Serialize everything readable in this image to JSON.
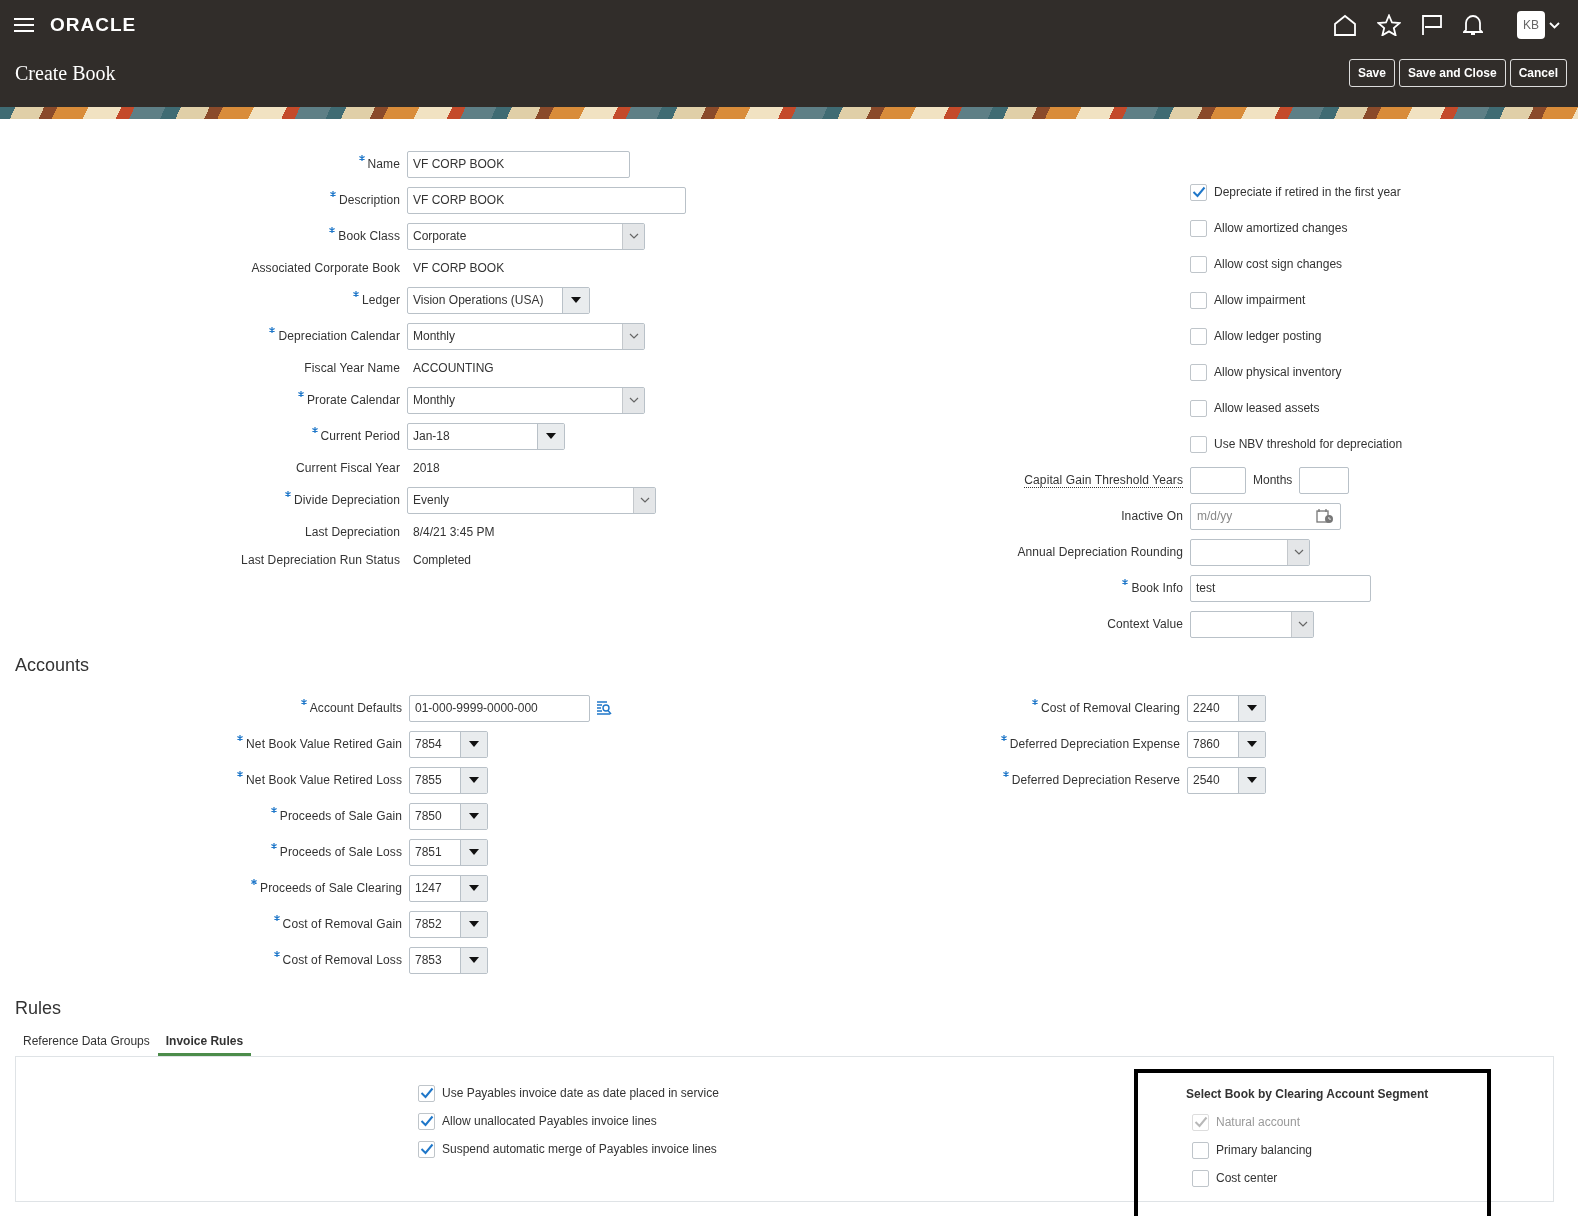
{
  "header": {
    "logo": "ORACLE",
    "avatar": "KB"
  },
  "page_title": "Create Book",
  "buttons": [
    "Save",
    "Save and Close",
    "Cancel"
  ],
  "book_fields": [
    {
      "kind": "text",
      "label": "Name",
      "required": true,
      "value": "VF CORP BOOK"
    },
    {
      "kind": "text",
      "label": "Description",
      "required": true,
      "value": "VF CORP BOOK"
    },
    {
      "kind": "select",
      "label": "Book Class",
      "required": true,
      "value": "Corporate"
    },
    {
      "kind": "display",
      "label": "Associated Corporate Book",
      "required": false,
      "value": "VF CORP BOOK"
    },
    {
      "kind": "combo",
      "label": "Ledger",
      "required": true,
      "value": "Vision Operations (USA)"
    },
    {
      "kind": "select",
      "label": "Depreciation Calendar",
      "required": true,
      "value": "Monthly"
    },
    {
      "kind": "display",
      "label": "Fiscal Year Name",
      "required": false,
      "value": "ACCOUNTING"
    },
    {
      "kind": "select",
      "label": "Prorate Calendar",
      "required": true,
      "value": "Monthly"
    },
    {
      "kind": "combo",
      "label": "Current Period",
      "required": true,
      "value": "Jan-18"
    },
    {
      "kind": "display",
      "label": "Current Fiscal Year",
      "required": false,
      "value": "2018"
    },
    {
      "kind": "select",
      "label": "Divide Depreciation",
      "required": true,
      "value": "Evenly"
    },
    {
      "kind": "display",
      "label": "Last Depreciation",
      "required": false,
      "value": "8/4/21 3:45 PM"
    },
    {
      "kind": "display",
      "label": "Last Depreciation Run Status",
      "required": false,
      "value": "Completed"
    }
  ],
  "book_options": [
    {
      "label": "Depreciate if retired in the first year",
      "checked": true
    },
    {
      "label": "Allow amortized changes",
      "checked": false
    },
    {
      "label": "Allow cost sign changes",
      "checked": false
    },
    {
      "label": "Allow impairment",
      "checked": false
    },
    {
      "label": "Allow ledger posting",
      "checked": false
    },
    {
      "label": "Allow physical inventory",
      "checked": false
    },
    {
      "label": "Allow leased assets",
      "checked": false
    },
    {
      "label": "Use NBV threshold for depreciation",
      "checked": false
    }
  ],
  "book_extra_fields": [
    {
      "kind": "threshold",
      "label": "Capital Gain Threshold Years",
      "required": false,
      "second_label": "Months"
    },
    {
      "kind": "date",
      "label": "Inactive On",
      "required": false,
      "placeholder": "m/d/yy"
    },
    {
      "kind": "select",
      "label": "Annual Depreciation Rounding",
      "required": false
    },
    {
      "kind": "text",
      "label": "Book Info",
      "required": true,
      "value": "test"
    },
    {
      "kind": "select",
      "label": "Context Value",
      "required": false
    }
  ],
  "accounts": {
    "title": "Accounts",
    "left_fields": [
      {
        "kind": "lookup",
        "label": "Account Defaults",
        "required": true,
        "value": "01-000-9999-0000-000"
      },
      {
        "kind": "combo",
        "label": "Net Book Value Retired Gain",
        "required": true,
        "value": "7854"
      },
      {
        "kind": "combo",
        "label": "Net Book Value Retired Loss",
        "required": true,
        "value": "7855"
      },
      {
        "kind": "combo",
        "label": "Proceeds of Sale Gain",
        "required": true,
        "value": "7850"
      },
      {
        "kind": "combo",
        "label": "Proceeds of Sale Loss",
        "required": true,
        "value": "7851"
      },
      {
        "kind": "combo",
        "label": "Proceeds of Sale Clearing",
        "required": true,
        "value": "1247"
      },
      {
        "kind": "combo",
        "label": "Cost of Removal Gain",
        "required": true,
        "value": "7852"
      },
      {
        "kind": "combo",
        "label": "Cost of Removal Loss",
        "required": true,
        "value": "7853"
      }
    ],
    "right_fields": [
      {
        "kind": "combo",
        "label": "Cost of Removal Clearing",
        "required": true,
        "value": "2240"
      },
      {
        "kind": "combo",
        "label": "Deferred Depreciation Expense",
        "required": true,
        "value": "7860"
      },
      {
        "kind": "combo",
        "label": "Deferred Depreciation Reserve",
        "required": true,
        "value": "2540"
      }
    ]
  },
  "rules": {
    "title": "Rules",
    "tabs": [
      {
        "label": "Reference Data Groups",
        "selected": false
      },
      {
        "label": "Invoice Rules",
        "selected": true
      }
    ],
    "invoice_options": [
      {
        "label": "Use Payables invoice date as date placed in service",
        "checked": true
      },
      {
        "label": "Allow unallocated Payables invoice lines",
        "checked": true
      },
      {
        "label": "Suspend automatic merge of Payables invoice lines",
        "checked": true
      }
    ],
    "segment_group": {
      "title": "Select Book by Clearing Account Segment",
      "options": [
        {
          "label": "Natural account",
          "checked": true,
          "disabled": true
        },
        {
          "label": "Primary balancing",
          "checked": false,
          "disabled": false
        },
        {
          "label": "Cost center",
          "checked": false,
          "disabled": false
        }
      ]
    }
  }
}
